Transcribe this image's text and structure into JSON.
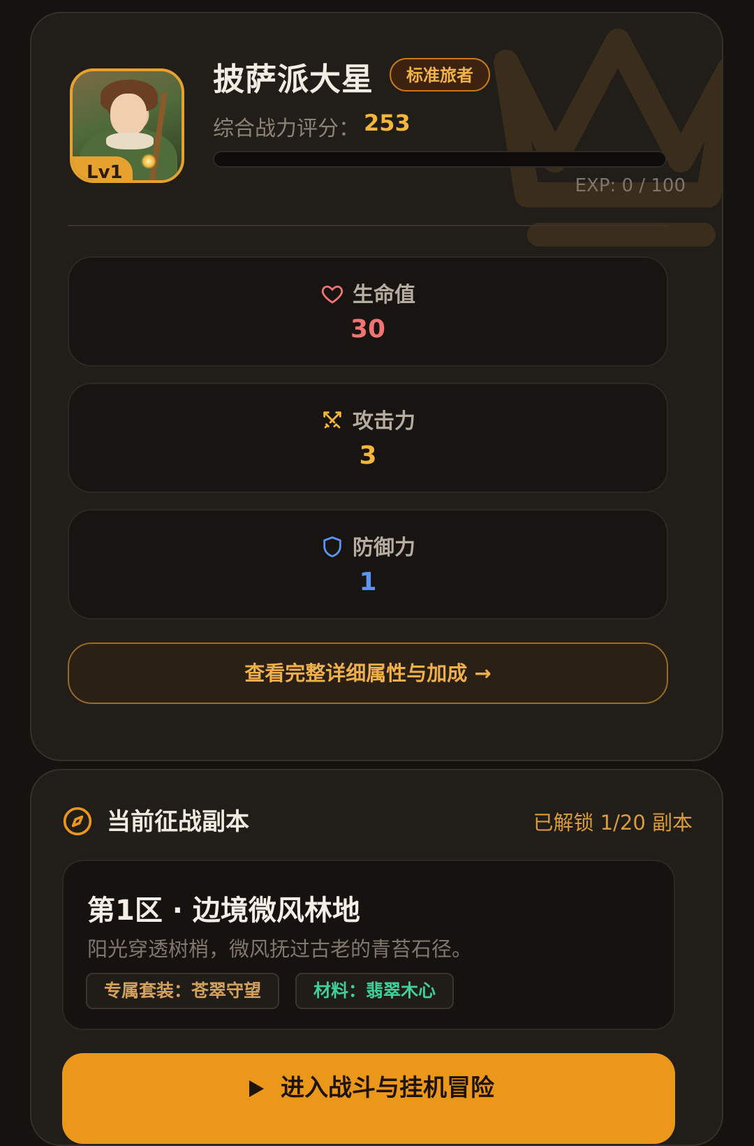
{
  "player": {
    "name": "披萨派大星",
    "title_badge": "标准旅者",
    "level_label": "Lv1",
    "power_label": "综合战力评分：",
    "power_value": "253",
    "exp_text": "EXP: 0 / 100",
    "exp_progress": 0
  },
  "stats": [
    {
      "label": "生命值",
      "value": "30",
      "icon": "heart-icon",
      "color": "#f07474"
    },
    {
      "label": "攻击力",
      "value": "3",
      "icon": "swords-icon",
      "color": "#f3b63a"
    },
    {
      "label": "防御力",
      "value": "1",
      "icon": "shield-icon",
      "color": "#5b95f0"
    }
  ],
  "detail_button": "查看完整详细属性与加成 →",
  "dungeon": {
    "section_title": "当前征战副本",
    "unlock_text": "已解锁 1/20 副本",
    "zone_name": "第1区 · 边境微风林地",
    "zone_desc": "阳光穿透树梢，微风抚过古老的青苔石径。",
    "set_tag": "专属套装：苍翠守望",
    "material_tag": "材料：翡翠木心",
    "enter_button": "进入战斗与挂机冒险"
  },
  "colors": {
    "accent": "#eb9719",
    "hp": "#f07474",
    "atk": "#f3b63a",
    "def": "#5b95f0",
    "material": "#3fcf9a"
  }
}
